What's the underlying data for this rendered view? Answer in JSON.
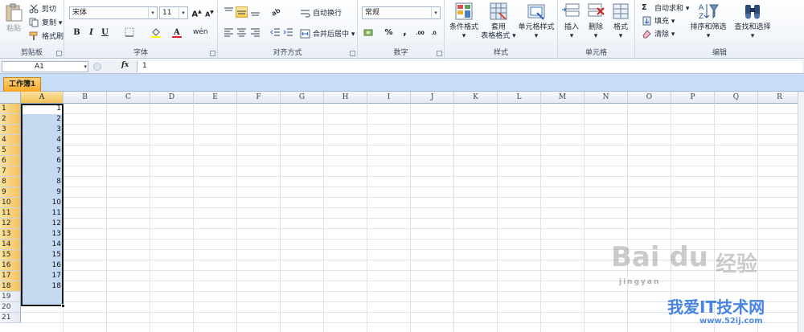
{
  "ribbon": {
    "clipboard": {
      "label": "剪贴板",
      "paste": "粘贴",
      "cut": "剪切",
      "copy": "复制 ▾",
      "format_painter": "格式刷"
    },
    "font": {
      "label": "字体",
      "font_name": "宋体",
      "font_size": "11",
      "bold": "B",
      "italic": "I",
      "underline": "U",
      "grow": "A",
      "shrink": "A",
      "phonetic": "wén"
    },
    "alignment": {
      "label": "对齐方式",
      "wrap_text": "自动换行",
      "merge_center": "合并后居中 ▾"
    },
    "number": {
      "label": "数字",
      "format": "常规",
      "percent": "%",
      "comma": ",",
      "inc_decimal": ".00",
      "dec_decimal": ".0"
    },
    "styles": {
      "label": "样式",
      "conditional": "条件格式",
      "table_line1": "套用",
      "table_line2": "表格格式 ▾",
      "cell_styles": "单元格样式"
    },
    "cells": {
      "label": "单元格",
      "insert": "插入",
      "delete": "删除",
      "format": "格式"
    },
    "editing": {
      "label": "编辑",
      "autosum": "自动求和 ▾",
      "fill": "填充 ▾",
      "clear": "清除 ▾",
      "sort_filter": "排序和筛选",
      "find_select": "查找和选择"
    }
  },
  "formula_bar": {
    "name_box": "A1",
    "fx": "fx",
    "content": "1"
  },
  "workbook": {
    "tab": "工作簿1"
  },
  "sheet": {
    "columns": [
      "A",
      "B",
      "C",
      "D",
      "E",
      "F",
      "G",
      "H",
      "I",
      "J",
      "K",
      "L",
      "M",
      "N",
      "O",
      "P",
      "Q",
      "R"
    ],
    "rows": [
      "1",
      "2",
      "3",
      "4",
      "5",
      "6",
      "7",
      "8",
      "9",
      "10",
      "11",
      "12",
      "13",
      "14",
      "15",
      "16",
      "17",
      "18",
      "19",
      "20",
      "21"
    ],
    "column_a_values": [
      "1",
      "2",
      "3",
      "4",
      "5",
      "6",
      "7",
      "8",
      "9",
      "10",
      "11",
      "12",
      "13",
      "14",
      "15",
      "16",
      "17",
      "18"
    ],
    "selected_column": "A",
    "selected_rows": 18
  },
  "watermark": {
    "brand": "Bai du",
    "brand_cn": "经验",
    "site_cn": "我爱IT技术网",
    "url": "www.52ij.com",
    "sub": "jingyan"
  },
  "colors": {
    "accent": "#f7a726",
    "selection": "#c5d9f1",
    "ribbon_bg": "#f4f7fb"
  }
}
